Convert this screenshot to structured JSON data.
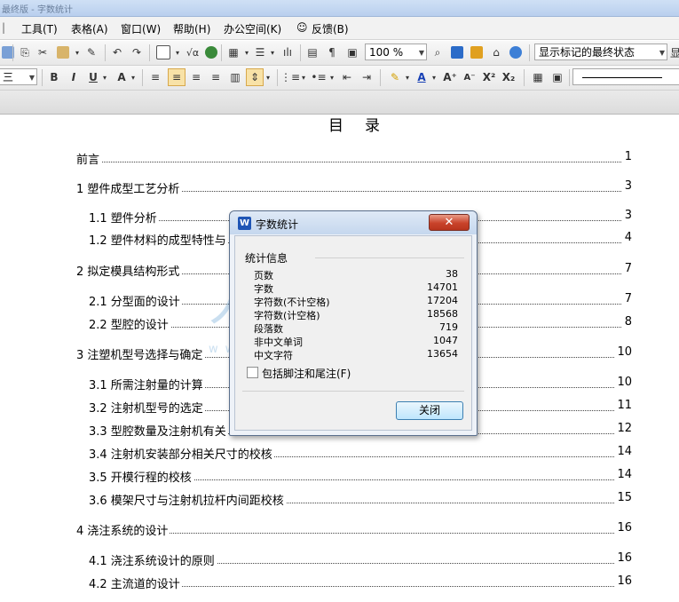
{
  "window": {
    "title": "最终版 - 字数统计"
  },
  "menubar": {
    "items": [
      "工具(T)",
      "表格(A)",
      "窗口(W)",
      "帮助(H)",
      "办公空间(K)",
      "反馈(B)"
    ]
  },
  "toolbar": {
    "zoom": "100 %",
    "track_mode": "显示标记的最终状态",
    "right_edge": "显",
    "style_combo": "三"
  },
  "document": {
    "heading": "目录",
    "toc": [
      {
        "text": "前言",
        "page": "1"
      },
      {
        "text": "1 塑件成型工艺分析",
        "page": "3"
      },
      {
        "text": "1.1 塑件分析",
        "page": "3"
      },
      {
        "text": "1.2 塑件材料的成型特性与",
        "page": "4"
      },
      {
        "text": "2 拟定模具结构形式",
        "page": "7"
      },
      {
        "text": "2.1 分型面的设计",
        "page": "7"
      },
      {
        "text": "2.2 型腔的设计",
        "page": "8"
      },
      {
        "text": "3 注塑机型号选择与确定",
        "page": "10"
      },
      {
        "text": "3.1 所需注射量的计算",
        "page": "10"
      },
      {
        "text": "3.2 注射机型号的选定",
        "page": "11"
      },
      {
        "text": "3.3 型腔数量及注射机有关",
        "page": "12"
      },
      {
        "text": "3.4 注射机安装部分相关尺寸的校核",
        "page": "14"
      },
      {
        "text": "3.5 开模行程的校核",
        "page": "14"
      },
      {
        "text": "3.6 模架尺寸与注射机拉杆内间距校核",
        "page": "15"
      },
      {
        "text": "4 浇注系统的设计",
        "page": "16"
      },
      {
        "text": "4.1 浇注系统设计的原则",
        "page": "16"
      },
      {
        "text": "4.2 主流道的设计",
        "page": "16"
      }
    ]
  },
  "dialog": {
    "title": "字数统计",
    "close_x": "✕",
    "section": "统计信息",
    "stats": [
      {
        "label": "页数",
        "value": "38"
      },
      {
        "label": "字数",
        "value": "14701"
      },
      {
        "label": "字符数(不计空格)",
        "value": "17204"
      },
      {
        "label": "字符数(计空格)",
        "value": "18568"
      },
      {
        "label": "段落数",
        "value": "719"
      },
      {
        "label": "非中文单词",
        "value": "1047"
      },
      {
        "label": "中文字符",
        "value": "13654"
      }
    ],
    "checkbox_label": "包括脚注和尾注(F)",
    "close_button": "关闭"
  },
  "watermark": {
    "text": "人人文库",
    "url": "www.renrendoc.com"
  },
  "colors": {
    "accent": "#1f55b5",
    "close_red": "#c9432b",
    "button_blue": "#bee6fd"
  }
}
